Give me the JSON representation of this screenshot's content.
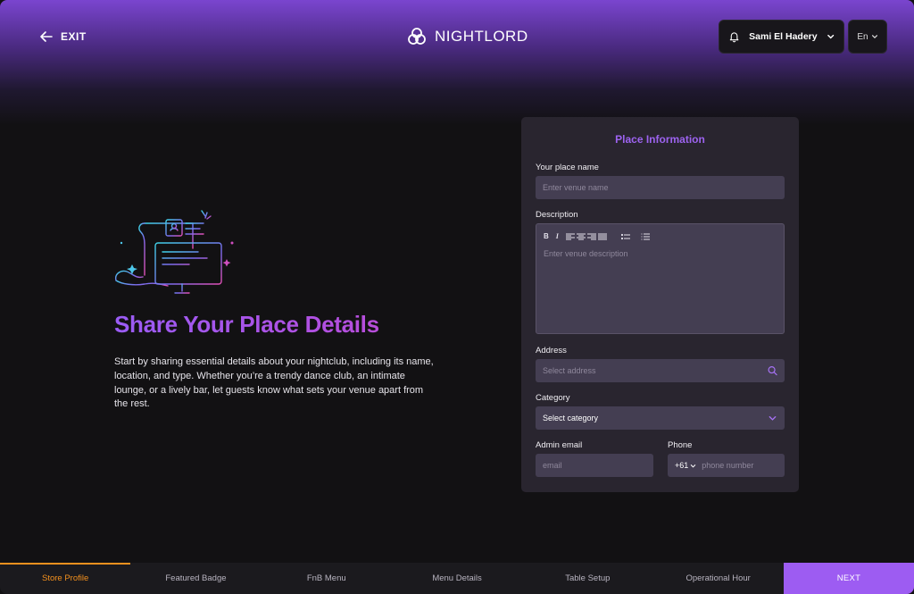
{
  "header": {
    "exit_label": "EXIT",
    "brand_name": "NIGHTLORD",
    "user_name": "Sami El Hadery",
    "language": "En"
  },
  "hero": {
    "title": "Share Your Place Details",
    "description": "Start by sharing essential details about your nightclub, including its name, location, and type. Whether you’re a trendy dance club, an intimate lounge, or a lively bar, let guests know what sets your venue apart from the rest."
  },
  "form": {
    "title": "Place Information",
    "place_name": {
      "label": "Your place name",
      "placeholder": "Enter venue name",
      "value": ""
    },
    "description": {
      "label": "Description",
      "placeholder": "Enter venue description",
      "toolbar": [
        "bold-icon",
        "italic-icon",
        "align-left-icon",
        "align-center-icon",
        "align-right-icon",
        "justify-icon",
        "bullet-list-icon",
        "numbered-list-icon"
      ],
      "bold_glyph": "B",
      "italic_glyph": "I"
    },
    "address": {
      "label": "Address",
      "placeholder": "Select address",
      "icon": "search-icon"
    },
    "category": {
      "label": "Category",
      "value": "Select category",
      "icon": "chevron-down-icon"
    },
    "admin_email": {
      "label": "Admin email",
      "placeholder": "email"
    },
    "phone": {
      "label": "Phone",
      "country_code": "+61",
      "placeholder": "phone number"
    }
  },
  "steps": [
    {
      "label": "Store Profile",
      "active": true
    },
    {
      "label": "Featured Badge",
      "active": false
    },
    {
      "label": "FnB Menu",
      "active": false
    },
    {
      "label": "Menu Details",
      "active": false
    },
    {
      "label": "Table Setup",
      "active": false
    },
    {
      "label": "Operational Hour",
      "active": false
    }
  ],
  "next_label": "NEXT",
  "colors": {
    "accent_purple": "#9d5cf2",
    "active_step_orange": "#f4911e",
    "card_bg": "#29252f",
    "field_bg": "#443e52",
    "page_bg": "#121113"
  }
}
